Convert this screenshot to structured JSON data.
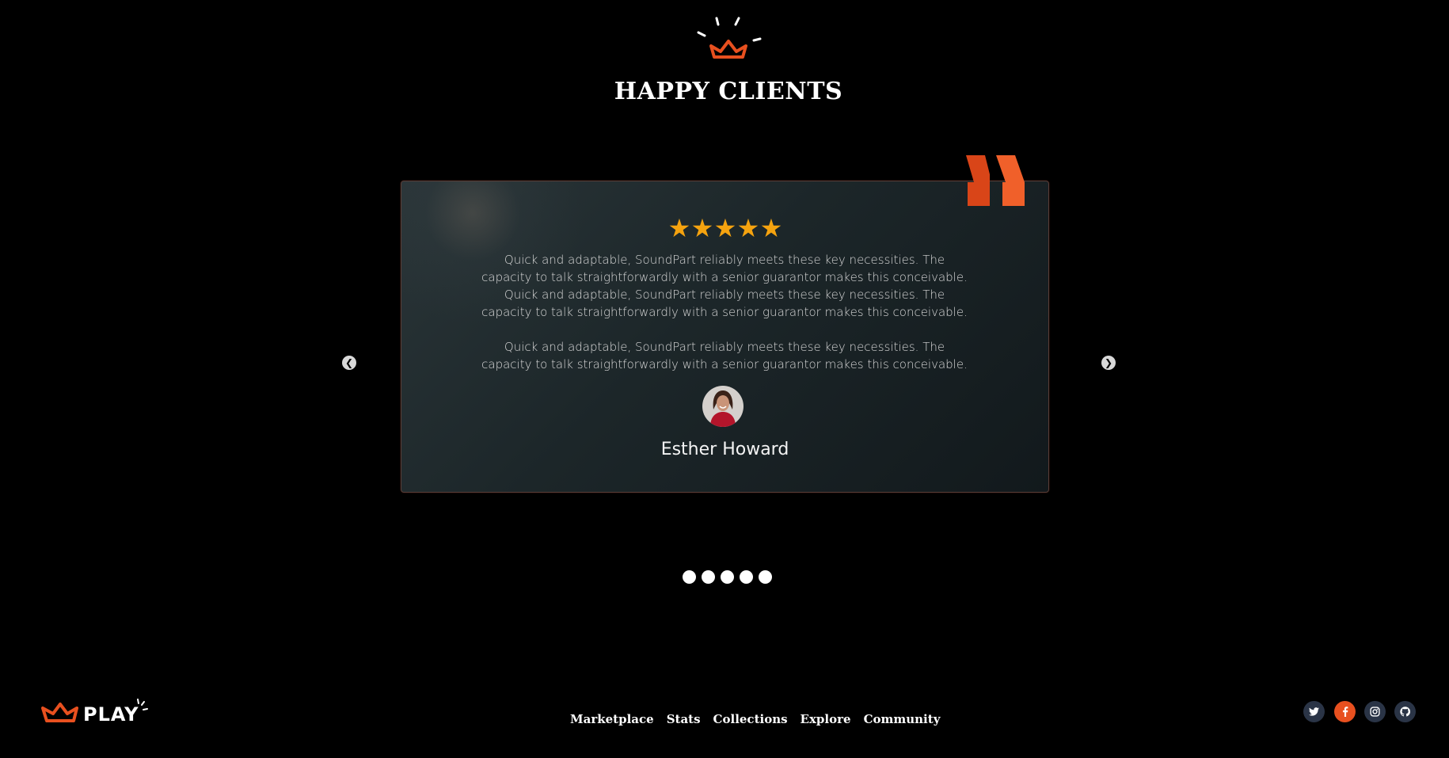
{
  "section": {
    "title": "HAPPY CLIENTS"
  },
  "testimonial": {
    "rating": 5,
    "stars": [
      "★",
      "★",
      "★",
      "★",
      "★"
    ],
    "paragraph_1": "Quick and adaptable, SoundPart reliably meets these key necessities. The capacity to talk straightforwardly with a senior guarantor makes this conceivable. Quick and adaptable, SoundPart reliably meets these key necessities. The capacity to talk straightforwardly with a senior guarantor makes this conceivable.",
    "paragraph_2": "Quick and adaptable, SoundPart reliably meets these key necessities. The capacity to talk straightforwardly with a senior guarantor makes this conceivable.",
    "reviewer": "Esther Howard"
  },
  "carousel": {
    "prev_icon": "❮",
    "next_icon": "❯",
    "dot_count": 5
  },
  "footer": {
    "logo_text": "PLAY",
    "nav": [
      "Marketplace",
      "Stats",
      "Collections",
      "Explore",
      "Community"
    ],
    "social": [
      "twitter-icon",
      "facebook-icon",
      "instagram-icon",
      "github-icon"
    ]
  },
  "colors": {
    "accent": "#e8501f",
    "star": "#f5a30f",
    "social_bg": "#2a3446"
  }
}
